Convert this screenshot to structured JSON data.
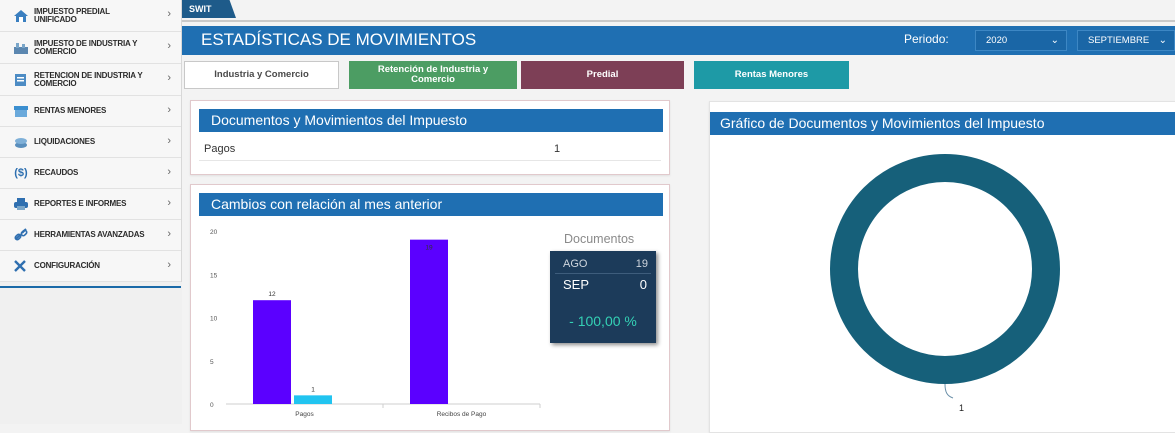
{
  "sidebar": {
    "items": [
      {
        "label": "IMPUESTO PREDIAL UNIFICADO",
        "icon": "house-tax-icon"
      },
      {
        "label": "IMPUESTO DE INDUSTRIA Y COMERCIO",
        "icon": "industry-icon"
      },
      {
        "label": "RETENCION DE INDUSTRIA Y COMERCIO",
        "icon": "document-retention-icon"
      },
      {
        "label": "RENTAS MENORES",
        "icon": "shop-icon"
      },
      {
        "label": "LIQUIDACIONES",
        "icon": "coins-icon"
      },
      {
        "label": "RECAUDOS",
        "icon": "dollar-circle-icon"
      },
      {
        "label": "REPORTES E INFORMES",
        "icon": "printer-icon"
      },
      {
        "label": "HERRAMIENTAS AVANZADAS",
        "icon": "link-icon"
      },
      {
        "label": "CONFIGURACIÓN",
        "icon": "tools-icon"
      }
    ]
  },
  "topbar": {
    "tab_label": "SWIT"
  },
  "header": {
    "title": "ESTADÍSTICAS DE MOVIMIENTOS",
    "period_label": "Periodo:",
    "year_value": "2020",
    "month_value": "SEPTIEMBRE"
  },
  "tabs": [
    {
      "label": "Industria y Comercio",
      "bg": "#ffffff",
      "color": "#4a4a4a"
    },
    {
      "label": "Retención de Industria y Comercio",
      "bg": "#4c9d63",
      "color": "#ffffff"
    },
    {
      "label": "Predial",
      "bg": "#7d3f56",
      "color": "#ffffff"
    },
    {
      "label": "Rentas Menores",
      "bg": "#1e9aa6",
      "color": "#ffffff"
    }
  ],
  "docs_panel": {
    "title": "Documentos y Movimientos del Impuesto",
    "rows": [
      {
        "label": "Pagos",
        "value": "1"
      }
    ]
  },
  "changes_panel": {
    "title": "Cambios con relación al mes anterior",
    "kpi": {
      "title": "Documentos",
      "prev_label": "AGO",
      "prev_value": "19",
      "curr_label": "SEP",
      "curr_value": "0",
      "change": "- 100,00 %"
    }
  },
  "donut_panel": {
    "title": "Gráfico de Documentos y Movimientos del Impuesto",
    "label_value": "1"
  },
  "chart_data": [
    {
      "type": "bar",
      "categories": [
        "Pagos",
        "Recibos de Pago"
      ],
      "series": [
        {
          "values": [
            12,
            19
          ],
          "color": "#5b00ff",
          "labels": [
            "12",
            "19"
          ]
        },
        {
          "values": [
            1,
            0
          ],
          "color": "#21c4f0",
          "labels": [
            "1",
            ""
          ]
        }
      ],
      "ylim": [
        0,
        20
      ],
      "yticks": [
        "0",
        "5",
        "10",
        "15",
        "20"
      ]
    },
    {
      "type": "pie",
      "values": [
        1
      ],
      "labels": [
        "1"
      ],
      "colors": [
        "#16607a"
      ]
    }
  ]
}
